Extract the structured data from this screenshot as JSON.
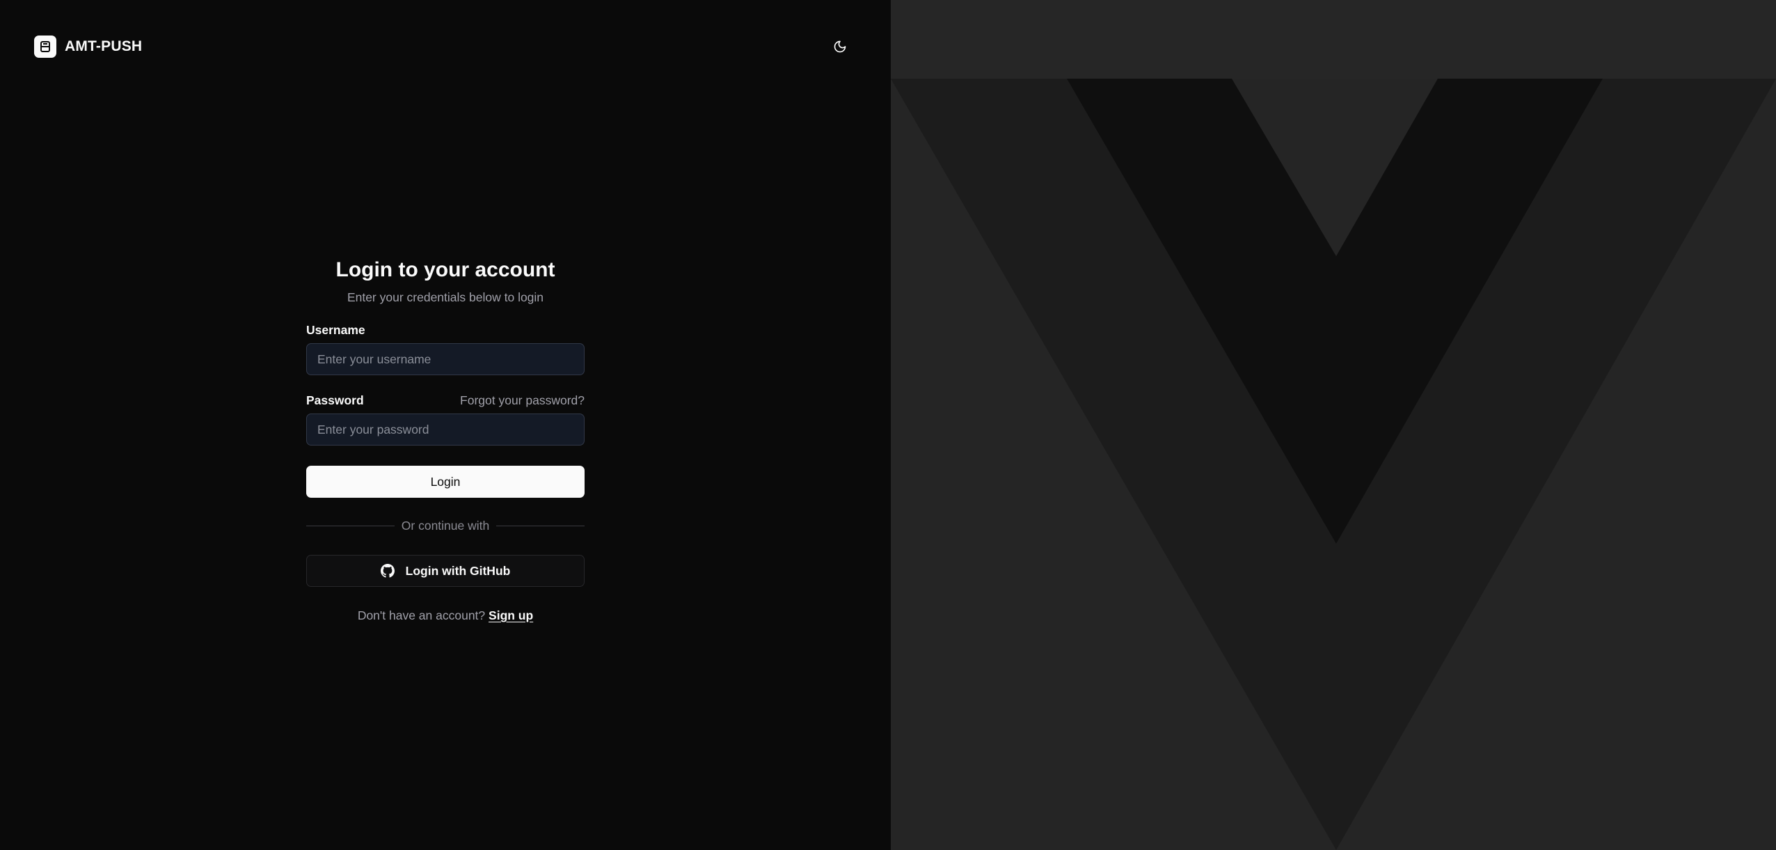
{
  "header": {
    "app_name": "AMT-PUSH",
    "logo_icon": "app-logo-icon",
    "theme_toggle_icon": "moon-icon"
  },
  "login": {
    "title": "Login to your account",
    "subtitle": "Enter your credentials below to login",
    "username": {
      "label": "Username",
      "placeholder": "Enter your username",
      "value": ""
    },
    "password": {
      "label": "Password",
      "placeholder": "Enter your password",
      "value": "",
      "forgot_link": "Forgot your password?"
    },
    "submit_label": "Login",
    "divider_text": "Or continue with",
    "github_label": "Login with GitHub",
    "github_icon": "github-icon",
    "signup_prompt": "Don't have an account?",
    "signup_link": "Sign up"
  },
  "colors": {
    "left_background": "#0a0a0a",
    "right_background": "#262626",
    "input_background": "#141a26",
    "primary_button": "#fafafa",
    "muted_text": "#a1a1aa"
  }
}
